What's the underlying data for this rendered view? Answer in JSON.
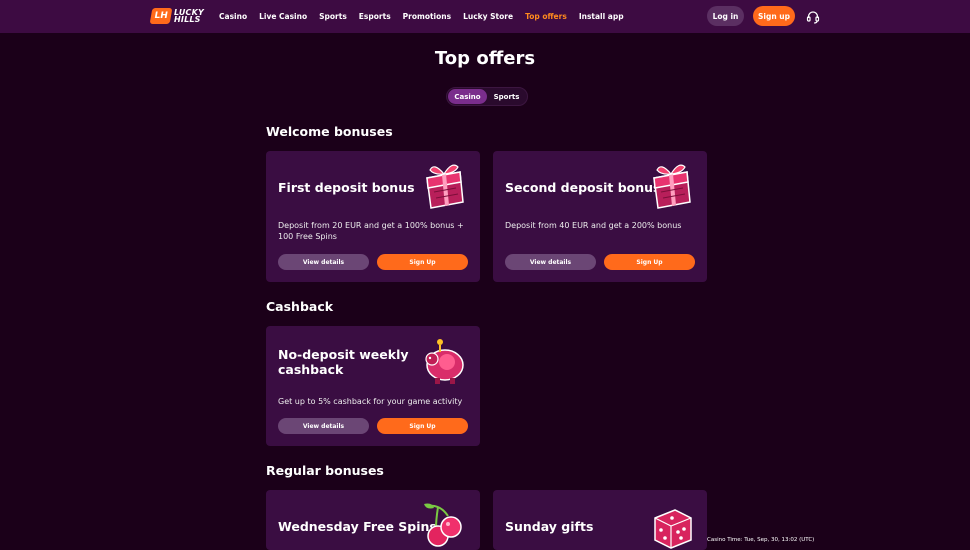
{
  "header": {
    "logo_mark": "LH",
    "logo_line1": "LUCKY",
    "logo_line2": "HILLS",
    "nav": [
      "Casino",
      "Live Casino",
      "Sports",
      "Esports",
      "Promotions",
      "Lucky Store",
      "Top offers",
      "Install app"
    ],
    "active_nav": "Top offers",
    "login_label": "Log in",
    "signup_label": "Sign up",
    "support_icon": "headset-icon"
  },
  "page": {
    "title": "Top offers",
    "tabs": [
      "Casino",
      "Sports"
    ],
    "active_tab": "Casino"
  },
  "sections": {
    "welcome": "Welcome bonuses",
    "cashback": "Cashback",
    "regular": "Regular bonuses"
  },
  "cards": {
    "first_deposit": {
      "title": "First deposit bonus",
      "desc": "Deposit from 20 EUR and get a 100% bonus + 100 Free Spins",
      "details": "View details",
      "signup": "Sign Up",
      "icon": "gift-icon"
    },
    "second_deposit": {
      "title": "Second deposit bonus",
      "desc": "Deposit from 40 EUR and get a 200% bonus",
      "details": "View details",
      "signup": "Sign Up",
      "icon": "gift-icon"
    },
    "cashback": {
      "title_line1": "No-deposit weekly",
      "title_line2": "cashback",
      "desc": "Get up to 5% cashback for your game activity",
      "details": "View details",
      "signup": "Sign Up",
      "icon": "piggy-bank-icon"
    },
    "wednesday": {
      "title": "Wednesday Free Spins",
      "icon": "cherry-icon"
    },
    "sunday": {
      "title": "Sunday gifts",
      "icon": "dice-icon"
    }
  },
  "footer": {
    "casino_time": "Casino Time: Tue, Sep, 30, 13:02 (UTC)"
  },
  "colors": {
    "background": "#1b0019",
    "header": "#3d0b42",
    "card": "#3a0d42",
    "accent": "#ff6a1b",
    "active_nav": "#ff8a1e",
    "tab_active": "#7a2d8c"
  }
}
